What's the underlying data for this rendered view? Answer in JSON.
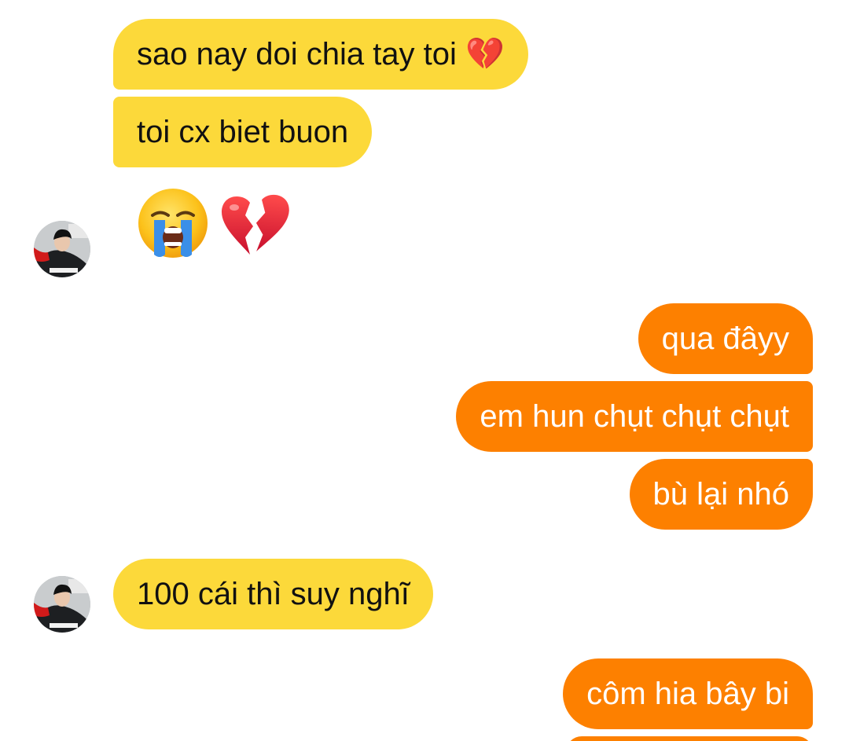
{
  "colors": {
    "incoming_bubble": "#fcd93a",
    "outgoing_bubble": "#fd8000",
    "incoming_text": "#111111",
    "outgoing_text": "#ffffff"
  },
  "messages": [
    {
      "sender": "them",
      "text": "sao nay doi chia tay toi 💔"
    },
    {
      "sender": "them",
      "text": "toi cx biet buon"
    },
    {
      "sender": "them",
      "emoji": [
        "loudly-crying-face-emoji",
        "broken-heart-emoji"
      ]
    },
    {
      "sender": "me",
      "text": "qua đâyy"
    },
    {
      "sender": "me",
      "text": "em hun chụt chụt chụt"
    },
    {
      "sender": "me",
      "text": "bù lại nhó"
    },
    {
      "sender": "them",
      "text": "100 cái thì suy nghĩ"
    },
    {
      "sender": "me",
      "text": "côm hia bây bi"
    }
  ]
}
